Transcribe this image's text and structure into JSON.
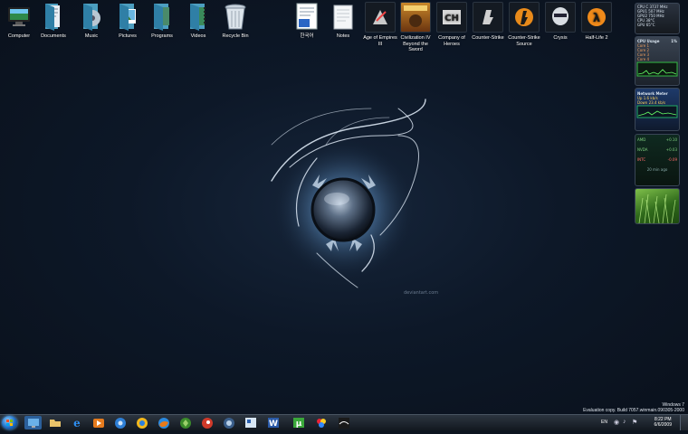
{
  "desktop_icons": [
    {
      "name": "computer-icon",
      "label": "Computer"
    },
    {
      "name": "documents-icon",
      "label": "Documents"
    },
    {
      "name": "music-icon",
      "label": "Music"
    },
    {
      "name": "pictures-icon",
      "label": "Pictures"
    },
    {
      "name": "programs-icon",
      "label": "Programs"
    },
    {
      "name": "videos-icon",
      "label": "Videos"
    },
    {
      "name": "recycle-bin-icon",
      "label": "Recycle Bin"
    },
    {
      "name": "korean-document-icon",
      "label": "한국어"
    },
    {
      "name": "notes-icon",
      "label": "Notes"
    },
    {
      "name": "age-of-empires-icon",
      "label": "Age of Empires III"
    },
    {
      "name": "civilization-icon",
      "label": "Civilization IV Beyond the Sword"
    },
    {
      "name": "company-of-heroes-icon",
      "label": "Company of Heroes"
    },
    {
      "name": "counter-strike-icon",
      "label": "Counter-Strike"
    },
    {
      "name": "counter-strike-source-icon",
      "label": "Counter-Strike Source"
    },
    {
      "name": "crysis-icon",
      "label": "Crysis"
    },
    {
      "name": "half-life-2-icon",
      "label": "Half-Life 2"
    }
  ],
  "gadgets": {
    "system": {
      "lines": [
        "CPU C  3737 MHz",
        "GPU1  507 MHz",
        "GPU2  750 MHz",
        "CPU  38°C",
        "GPU  65°C"
      ]
    },
    "cpu": {
      "title": "CPU Usage",
      "value": "1%",
      "cores": [
        "Core 1",
        "Core 2",
        "Core 3",
        "Core 4"
      ]
    },
    "network": {
      "title": "Network Meter",
      "lines": [
        "Up  1.6 kb/s",
        "Down  23.4 kb/s"
      ]
    },
    "stocks": {
      "rows": [
        {
          "symbol": "AMD",
          "change": "+0.10"
        },
        {
          "symbol": "NVDA",
          "change": "+0.03"
        },
        {
          "symbol": "INTC",
          "change": "-0.09"
        }
      ],
      "footer": "20 min ago"
    }
  },
  "taskbar": {
    "start_label": "Start",
    "pinned": [
      {
        "name": "explorer-icon"
      },
      {
        "name": "folder-icon"
      },
      {
        "name": "internet-explorer-icon"
      },
      {
        "name": "media-player-icon"
      },
      {
        "name": "chrome-icon"
      },
      {
        "name": "safari-icon"
      },
      {
        "name": "firefox-icon"
      },
      {
        "name": "opera-icon"
      },
      {
        "name": "steam-icon"
      },
      {
        "name": "photoshop-icon"
      },
      {
        "name": "word-icon"
      },
      {
        "name": "utorrent-icon"
      },
      {
        "name": "paint-icon"
      },
      {
        "name": "winamp-icon"
      }
    ],
    "language": "EN",
    "time": "8:22 PM",
    "date": "6/6/2009"
  },
  "watermark": {
    "line1": "Windows 7",
    "line2": "Evaluation copy. Build 7057.winmain.090305-2000"
  },
  "wallpaper": {
    "credit": "deviantart.com"
  }
}
